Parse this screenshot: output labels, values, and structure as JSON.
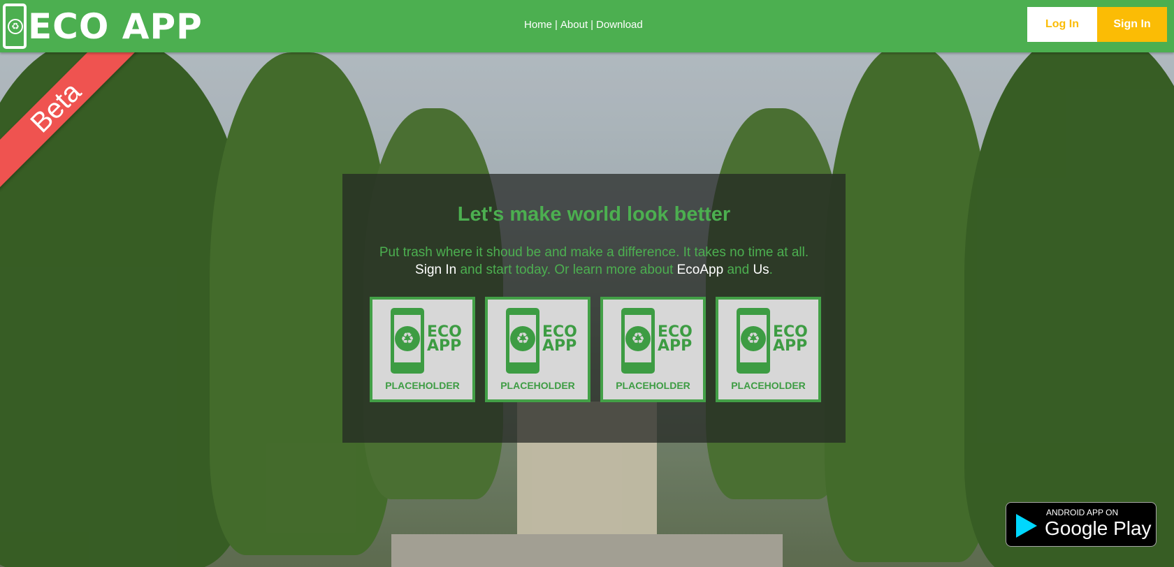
{
  "header": {
    "logo_text": "ECO APP",
    "nav": {
      "home": "Home",
      "about": "About",
      "download": "Download",
      "sep": "|"
    },
    "login_label": "Log In",
    "signin_label": "Sign In"
  },
  "ribbon": {
    "label": "Beta"
  },
  "hero": {
    "title": "Let's make world look better",
    "line1": "Put trash where it shoud be and make a difference. It takes no time at all.",
    "signin_link": "Sign In",
    "mid1": " and start today. Or learn more about ",
    "ecoapp_link": "EcoApp",
    "mid2": " and ",
    "us_link": "Us",
    "end": "."
  },
  "tiles": [
    {
      "eco1": "ECO",
      "eco2": "APP",
      "label": "PLACEHOLDER"
    },
    {
      "eco1": "ECO",
      "eco2": "APP",
      "label": "PLACEHOLDER"
    },
    {
      "eco1": "ECO",
      "eco2": "APP",
      "label": "PLACEHOLDER"
    },
    {
      "eco1": "ECO",
      "eco2": "APP",
      "label": "PLACEHOLDER"
    }
  ],
  "badge": {
    "small": "ANDROID APP ON",
    "big": "Google Play"
  },
  "colors": {
    "brand_green": "#4caf50",
    "accent_yellow": "#fbbc05",
    "ribbon_red": "#ef5350"
  },
  "icons": {
    "logo": "phone-recycle-icon",
    "tile": "phone-recycle-icon",
    "badge": "google-play-icon"
  }
}
